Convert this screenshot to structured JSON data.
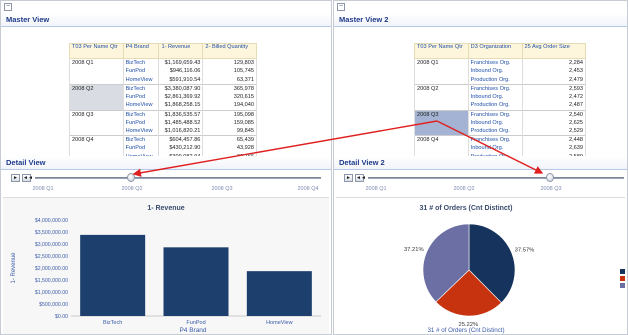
{
  "left_pane": {
    "collapse_icon": "minus-box-icon",
    "master_title": "Master View",
    "table": {
      "headers": [
        "T03 Per Name Qtr",
        "P4 Brand",
        "1- Revenue",
        "2- Billed Quantity"
      ],
      "groups": [
        {
          "qtr": "2008 Q1",
          "rows": [
            [
              "BizTech",
              "$1,169,659.43",
              "129,803"
            ],
            [
              "FunPod",
              "$946,116.06",
              "105,745"
            ],
            [
              "HomeView",
              "$591,910.54",
              "63,371"
            ]
          ]
        },
        {
          "qtr": "2008 Q2",
          "rows": [
            [
              "BizTech",
              "$3,380,087.90",
              "365,978"
            ],
            [
              "FunPod",
              "$2,861,369.92",
              "320,615"
            ],
            [
              "HomeView",
              "$1,868,258.15",
              "194,040"
            ]
          ]
        },
        {
          "qtr": "2008 Q3",
          "rows": [
            [
              "BizTech",
              "$1,836,535.57",
              "195,098"
            ],
            [
              "FunPod",
              "$1,485,488.52",
              "159,085"
            ],
            [
              "HomeView",
              "$1,016,820.21",
              "99,845"
            ]
          ]
        },
        {
          "qtr": "2008 Q4",
          "rows": [
            [
              "BizTech",
              "$604,457.86",
              "65,439"
            ],
            [
              "FunPod",
              "$430,212.90",
              "43,928"
            ],
            [
              "HomeView",
              "$309,082.94",
              "30,766"
            ]
          ]
        }
      ]
    },
    "detail_title": "Detail View",
    "slider": {
      "buttons": [
        "►",
        "◄◄"
      ],
      "labels": [
        "2008 Q1",
        "2008 Q2",
        "2008 Q3",
        "2008 Q4"
      ],
      "selected": "2008 Q2"
    },
    "chart_data": {
      "type": "bar",
      "title": "1- Revenue",
      "xlabel": "P4 Brand",
      "ylabel": "1- Revenue",
      "categories": [
        "BizTech",
        "FunPod",
        "HomeView"
      ],
      "values": [
        3380087.9,
        2861369.92,
        1868258.15
      ],
      "ylim": [
        0,
        4000000
      ],
      "ticks": [
        "$0.00",
        "$500,000.00",
        "$1,000,000.00",
        "$1,500,000.00",
        "$2,000,000.00",
        "$2,500,000.00",
        "$3,000,000.00",
        "$3,500,000.00",
        "$4,000,000.00"
      ],
      "bar_color": "#1d3f6e"
    }
  },
  "right_pane": {
    "collapse_icon": "minus-box-icon",
    "master_title": "Master View 2",
    "table": {
      "headers": [
        "T03 Per Name Qtr",
        "D3 Organization",
        "25 Avg Order Size"
      ],
      "groups": [
        {
          "qtr": "2008 Q1",
          "rows": [
            [
              "Franchises Org.",
              "2,284"
            ],
            [
              "Inbound Org.",
              "2,453"
            ],
            [
              "Production Org.",
              "2,479"
            ]
          ]
        },
        {
          "qtr": "2008 Q2",
          "rows": [
            [
              "Franchises Org.",
              "2,593"
            ],
            [
              "Inbound Org.",
              "2,472"
            ],
            [
              "Production Org.",
              "2,487"
            ]
          ]
        },
        {
          "qtr": "2008 Q3",
          "rows": [
            [
              "Franchises Org.",
              "2,540"
            ],
            [
              "Inbound Org.",
              "2,625"
            ],
            [
              "Production Org.",
              "2,529"
            ]
          ]
        },
        {
          "qtr": "2008 Q4",
          "rows": [
            [
              "Franchises Org.",
              "2,448"
            ],
            [
              "Inbound Org.",
              "2,639"
            ],
            [
              "Production Org.",
              "2,589"
            ]
          ]
        }
      ]
    },
    "detail_title": "Detail View 2",
    "slider": {
      "buttons": [
        "►",
        "◄◄"
      ],
      "labels": [
        "2008 Q1",
        "2008 Q2",
        "2008 Q3"
      ],
      "selected": "2008 Q3"
    },
    "chart_data": {
      "type": "pie",
      "title": "31 # of Orders (Cnt Distinct)",
      "footer": "31 # of Orders  (Cnt Distinct)",
      "values": [
        37.57,
        25.22,
        37.21
      ],
      "labels": [
        "37.57%",
        "25.22%",
        "37.21%"
      ],
      "colors": [
        "#16335e",
        "#c8330f",
        "#6b6fa3"
      ]
    }
  },
  "annotation": {
    "arrow_color": "#e02020"
  }
}
